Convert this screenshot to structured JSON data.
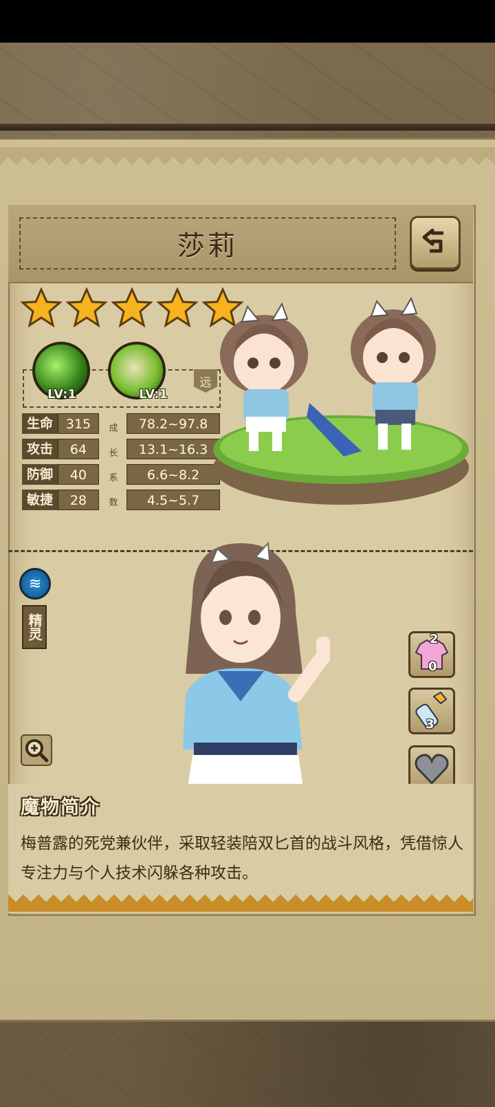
{
  "character": {
    "name": "莎莉",
    "star_count": 5,
    "range": "远"
  },
  "skills": [
    {
      "level": "LV:1"
    },
    {
      "level": "LV:1"
    }
  ],
  "stats": [
    {
      "label": "生命",
      "value": "315",
      "growth": "78.2~97.8"
    },
    {
      "label": "攻击",
      "value": "64",
      "growth": "13.1~16.3"
    },
    {
      "label": "防御",
      "value": "40",
      "growth": "6.6~8.2"
    },
    {
      "label": "敏捷",
      "value": "28",
      "growth": "4.5~5.7"
    }
  ],
  "growth_label": [
    "成",
    "长",
    "系",
    "数"
  ],
  "element": {
    "label": "精灵"
  },
  "side_items": {
    "outfit": {
      "top": "2",
      "bottom": "0"
    },
    "bottle": {
      "count": "3"
    }
  },
  "description": {
    "title": "魔物简介",
    "text": "梅普露的死党兼伙伴，采取轻装陪双匕首的战斗风格，凭借惊人专注力与个人技术闪躲各种攻击。"
  }
}
